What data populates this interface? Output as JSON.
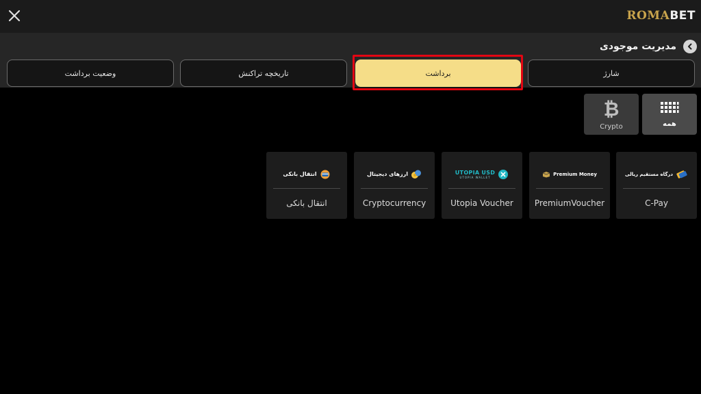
{
  "brand": {
    "part1": "ROMA",
    "part2": "BET"
  },
  "header": {
    "title": "مدیریت موجودی"
  },
  "tabs": [
    {
      "label": "وضعیت برداشت",
      "active": false
    },
    {
      "label": "تاریخچه تراکنش",
      "active": false
    },
    {
      "label": "برداشت",
      "active": true
    },
    {
      "label": "شارژ",
      "active": false
    }
  ],
  "filters": [
    {
      "label": "Crypto",
      "icon": "bitcoin-icon",
      "active": false
    },
    {
      "label": "همه",
      "icon": "grid-icon",
      "active": true
    }
  ],
  "methods": [
    {
      "logo_text": "انتقال بانکی",
      "name": "انتقال بانکی",
      "icon": "bank-card-icon"
    },
    {
      "logo_text": "ارزهای دیجیتال",
      "name": "Cryptocurrency",
      "icon": "coins-icon"
    },
    {
      "logo_text": "UTOPIA USD",
      "logo_sub": "UTOPIA WALLET",
      "name": "Utopia Voucher",
      "icon": "utopia-icon"
    },
    {
      "logo_text": "Premium Money",
      "name": "PremiumVoucher",
      "icon": "premium-icon"
    },
    {
      "logo_text": "درگاه مستقیم ریالی",
      "name": "C-Pay",
      "icon": "cpay-icon"
    }
  ],
  "colors": {
    "accent": "#f5dd88",
    "highlight": "#e30613",
    "brand_gold": "#c9a44c",
    "utopia": "#21b8c4"
  }
}
